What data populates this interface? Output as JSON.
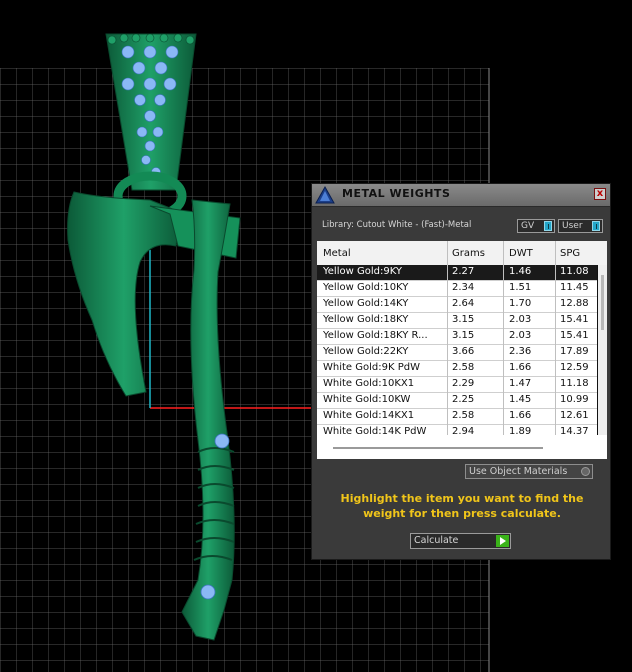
{
  "panel": {
    "title": "METAL WEIGHTS",
    "close_label": "x",
    "library_label": "Library: Cutout White - (Fast)-Metal",
    "toggles": [
      {
        "label": "GV"
      },
      {
        "label": "User"
      }
    ],
    "table": {
      "headers": [
        "Metal",
        "Grams",
        "DWT",
        "SPG"
      ],
      "selected_row": 0,
      "rows": [
        {
          "metal": "Yellow Gold:9KY",
          "grams": "2.27",
          "dwt": "1.46",
          "spg": "11.08"
        },
        {
          "metal": "Yellow Gold:10KY",
          "grams": "2.34",
          "dwt": "1.51",
          "spg": "11.45"
        },
        {
          "metal": "Yellow Gold:14KY",
          "grams": "2.64",
          "dwt": "1.70",
          "spg": "12.88"
        },
        {
          "metal": "Yellow Gold:18KY",
          "grams": "3.15",
          "dwt": "2.03",
          "spg": "15.41"
        },
        {
          "metal": "Yellow Gold:18KY R...",
          "grams": "3.15",
          "dwt": "2.03",
          "spg": "15.41"
        },
        {
          "metal": "Yellow Gold:22KY",
          "grams": "3.66",
          "dwt": "2.36",
          "spg": "17.89"
        },
        {
          "metal": "White Gold:9K PdW",
          "grams": "2.58",
          "dwt": "1.66",
          "spg": "12.59"
        },
        {
          "metal": "White Gold:10KX1",
          "grams": "2.29",
          "dwt": "1.47",
          "spg": "11.18"
        },
        {
          "metal": "White Gold:10KW",
          "grams": "2.25",
          "dwt": "1.45",
          "spg": "10.99"
        },
        {
          "metal": "White Gold:14KX1",
          "grams": "2.58",
          "dwt": "1.66",
          "spg": "12.61"
        },
        {
          "metal": "White Gold:14K PdW",
          "grams": "2.94",
          "dwt": "1.89",
          "spg": "14.37"
        }
      ]
    },
    "use_object_materials": "Use Object Materials",
    "hint": "Highlight the item you want to find the weight for then press calculate.",
    "calculate_label": "Calculate"
  },
  "colors": {
    "model_green": "#138a55",
    "gem_blue": "#8ab8f5",
    "hint_yellow": "#f0c51a",
    "toggle_blue": "#24a6c9",
    "go_green": "#3ab319",
    "axis_red": "#ff2020",
    "axis_cyan": "#1fb8c8"
  }
}
